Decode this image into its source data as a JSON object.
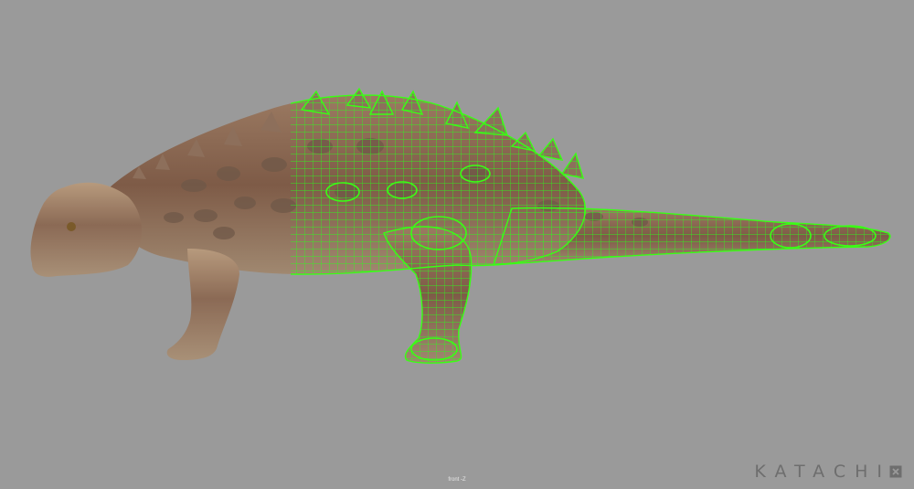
{
  "viewport": {
    "background": "#9a9a9a",
    "camera_label": "front -Z"
  },
  "model": {
    "texture_color": "#8a6d5a",
    "wireframe_color": "#39ff14",
    "icon": "ankylosaur-model"
  },
  "brand": {
    "name": "KATACHI",
    "icon": "square-x-icon"
  }
}
